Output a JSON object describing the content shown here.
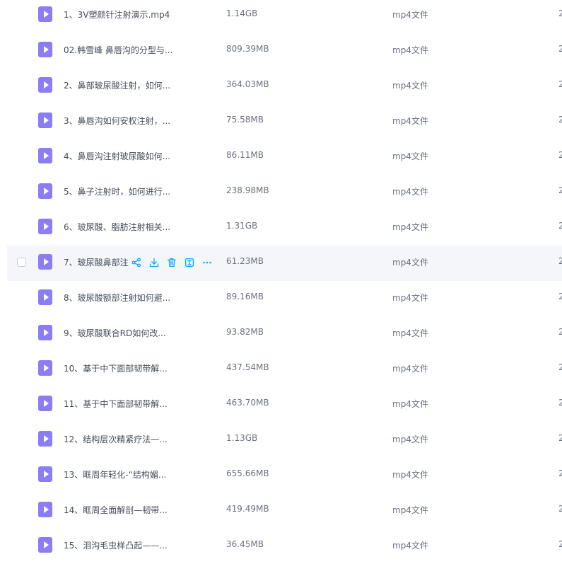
{
  "files": [
    {
      "name": "1、3V塑颜针注射演示.mp4",
      "size": "1.14GB",
      "type": "mp4文件",
      "extra": "2"
    },
    {
      "name": "02.韩雪峰 鼻唇沟的分型与...",
      "size": "809.39MB",
      "type": "mp4文件",
      "extra": "2"
    },
    {
      "name": "2、鼻部玻尿酸注射，如何...",
      "size": "364.03MB",
      "type": "mp4文件",
      "extra": "2"
    },
    {
      "name": "3、鼻唇沟如何安权注射，...",
      "size": "75.58MB",
      "type": "mp4文件",
      "extra": "2"
    },
    {
      "name": "4、鼻唇沟注射玻尿酸如何...",
      "size": "86.11MB",
      "type": "mp4文件",
      "extra": "2"
    },
    {
      "name": "5、鼻子注射时，如何进行...",
      "size": "238.98MB",
      "type": "mp4文件",
      "extra": "2"
    },
    {
      "name": "6、玻尿酸、脂肪注射相关...",
      "size": "1.31GB",
      "type": "mp4文件",
      "extra": "2"
    },
    {
      "name": "7、玻尿酸鼻部注",
      "size": "61.23MB",
      "type": "mp4文件",
      "extra": "2"
    },
    {
      "name": "8、玻尿酸额部注射如何避...",
      "size": "89.16MB",
      "type": "mp4文件",
      "extra": "2"
    },
    {
      "name": "9、玻尿酸联合RD如何改...",
      "size": "93.82MB",
      "type": "mp4文件",
      "extra": "2"
    },
    {
      "name": "10、基于中下面部韧带解...",
      "size": "437.54MB",
      "type": "mp4文件",
      "extra": "2"
    },
    {
      "name": "11、基于中下面部韧带解...",
      "size": "463.70MB",
      "type": "mp4文件",
      "extra": "2"
    },
    {
      "name": "12、结构层次精紧疗法—...",
      "size": "1.13GB",
      "type": "mp4文件",
      "extra": "2"
    },
    {
      "name": "13、眶周年轻化-“结构媚...",
      "size": "655.66MB",
      "type": "mp4文件",
      "extra": "2"
    },
    {
      "name": "14、眶周全面解剖—韧带...",
      "size": "419.49MB",
      "type": "mp4文件",
      "extra": "2"
    },
    {
      "name": "15、泪沟毛虫样凸起——...",
      "size": "36.45MB",
      "type": "mp4文件",
      "extra": "2"
    }
  ],
  "icons": {
    "file": "video-file-icon",
    "share": "share-icon",
    "download": "download-icon",
    "delete": "trash-icon",
    "detail": "info-icon",
    "more": "more-icon"
  },
  "colors": {
    "accent": "#06a7ff",
    "file_icon": "#8a7df6",
    "hover_bg": "#f5f6fa"
  }
}
